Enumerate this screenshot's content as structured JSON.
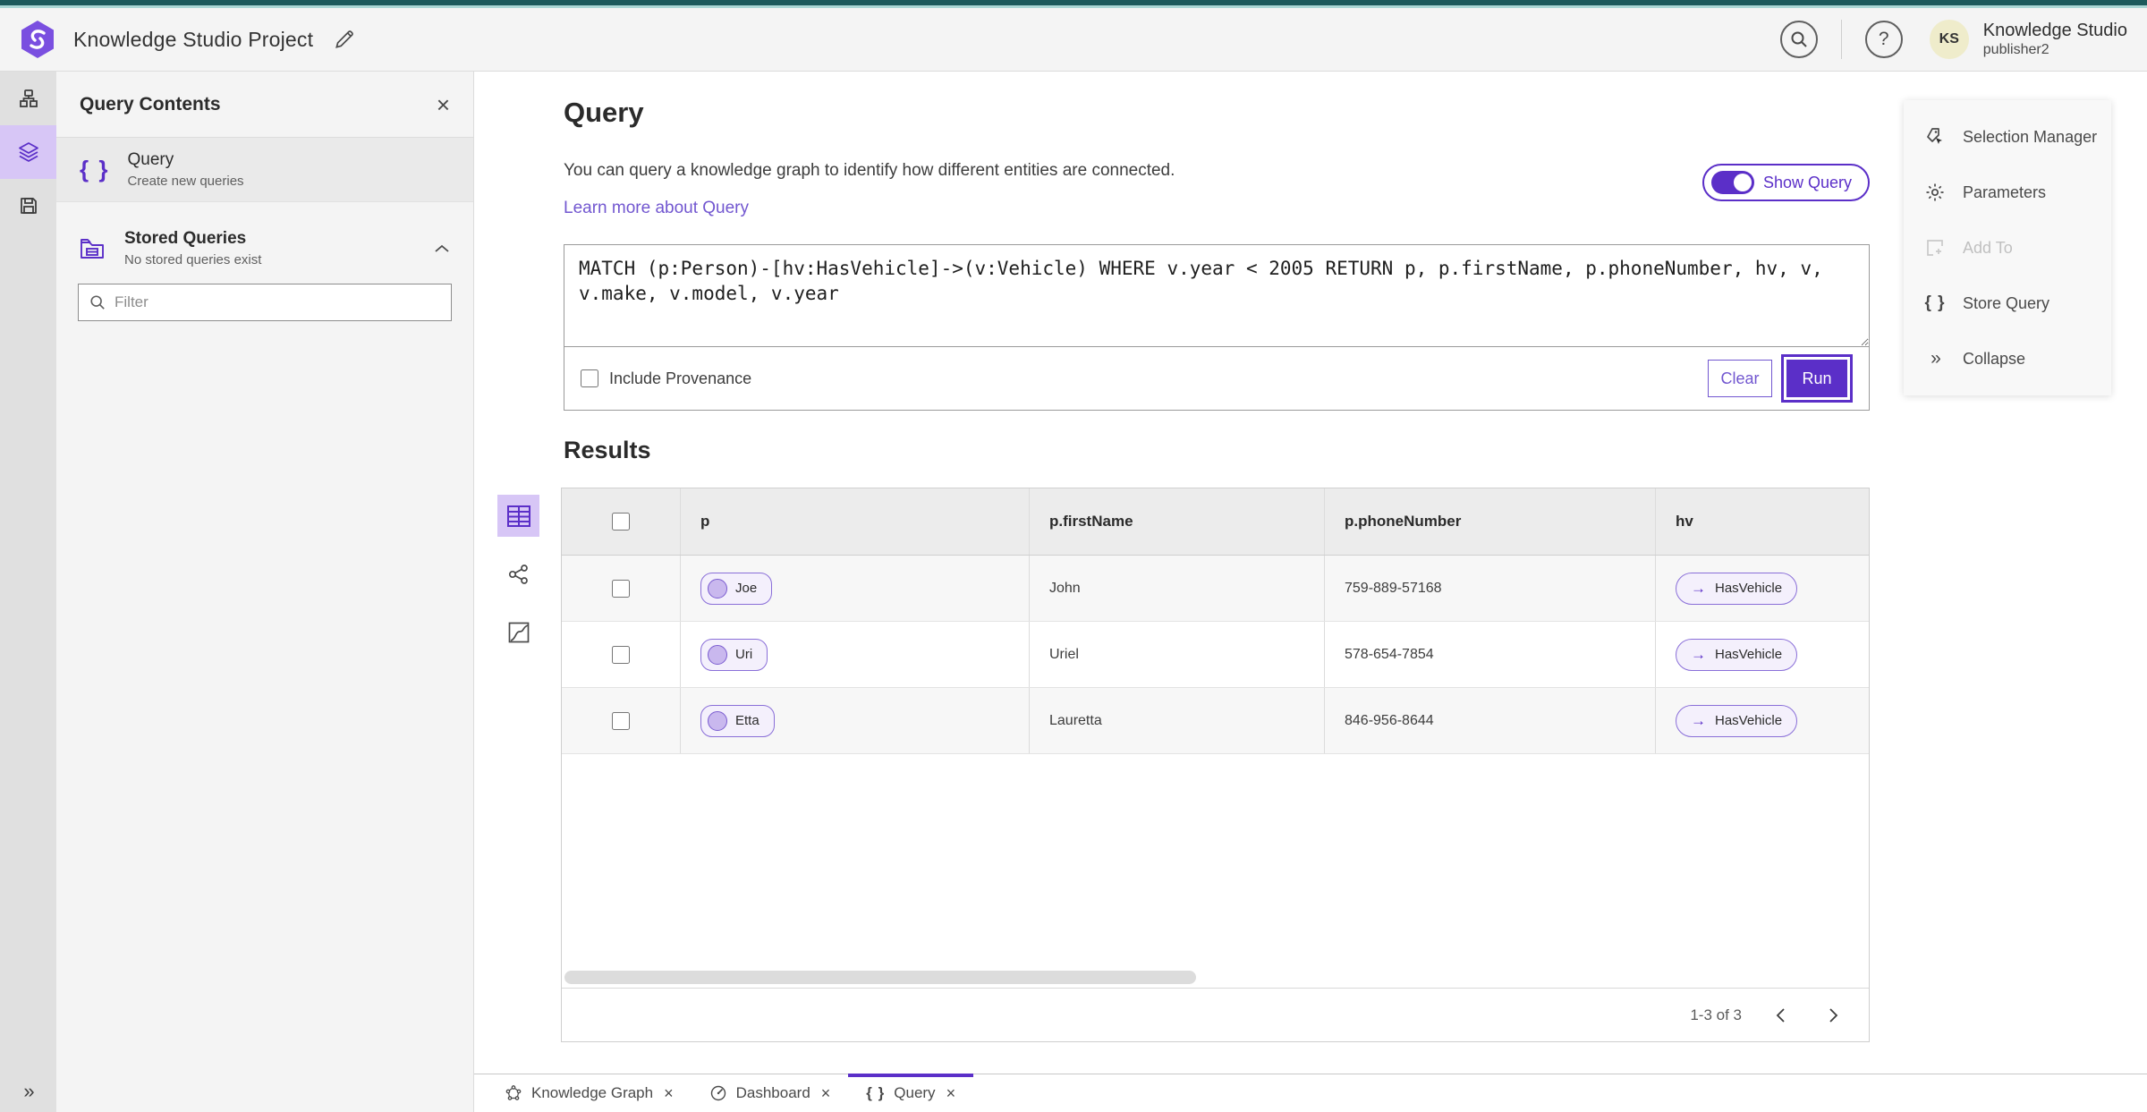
{
  "colors": {
    "accent": "#5b2fc8",
    "accent_light": "#d7c6f6",
    "link_purple": "#7257d0",
    "teal_dark": "#1d5a5c",
    "teal_light": "#abd7d5",
    "avatar_bg": "#efeccb"
  },
  "icons": {
    "close": "×",
    "braces": "{ }",
    "double_chevron": "»",
    "arrow_right": "→",
    "question_mark": "?",
    "caret_up": "⌃"
  },
  "header": {
    "title": "Knowledge Studio Project",
    "product_name": "Knowledge Studio",
    "user_name": "publisher2",
    "avatar_initials": "KS"
  },
  "side_panel": {
    "title": "Query Contents",
    "query_item": {
      "title": "Query",
      "subtitle": "Create new queries"
    },
    "stored_item": {
      "title": "Stored Queries",
      "subtitle": "No stored queries exist"
    },
    "filter_placeholder": "Filter"
  },
  "query_section": {
    "title": "Query",
    "description": "You can query a knowledge graph to identify how different entities are connected.",
    "learn_link": "Learn more about Query",
    "show_query_label": "Show Query",
    "query_text": "MATCH (p:Person)-[hv:HasVehicle]->(v:Vehicle) WHERE v.year < 2005 RETURN p, p.firstName, p.phoneNumber, hv, v, v.make, v.model, v.year",
    "include_provenance_label": "Include Provenance",
    "clear_label": "Clear",
    "run_label": "Run"
  },
  "actions_panel": {
    "items": [
      {
        "label": "Selection Manager"
      },
      {
        "label": "Parameters"
      },
      {
        "label": "Add To"
      },
      {
        "label": "Store Query"
      },
      {
        "label": "Collapse"
      }
    ]
  },
  "results": {
    "title": "Results",
    "columns": [
      "p",
      "p.firstName",
      "p.phoneNumber",
      "hv"
    ],
    "rows": [
      {
        "p": "Joe",
        "firstName": "John",
        "phoneNumber": "759-889-57168",
        "hv": "HasVehicle"
      },
      {
        "p": "Uri",
        "firstName": "Uriel",
        "phoneNumber": "578-654-7854",
        "hv": "HasVehicle"
      },
      {
        "p": "Etta",
        "firstName": "Lauretta",
        "phoneNumber": "846-956-8644",
        "hv": "HasVehicle"
      }
    ],
    "pagination": "1-3 of 3"
  },
  "tabs": [
    {
      "label": "Knowledge Graph"
    },
    {
      "label": "Dashboard"
    },
    {
      "label": "Query"
    }
  ]
}
